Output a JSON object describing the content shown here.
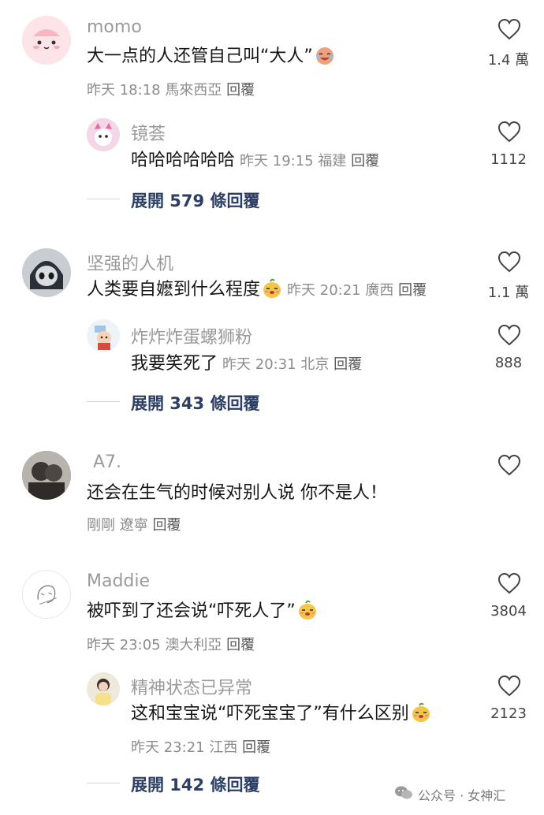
{
  "comments": [
    {
      "user": "momo",
      "text": "大一点的人还管自己叫“大人”",
      "time": "昨天 18:18",
      "location": "馬來西亞",
      "reply_label": "回覆",
      "likes": "1.4 萬",
      "emoji": "laugh-cry-emoji",
      "sub": {
        "user": "镜荟",
        "text": "哈哈哈哈哈哈",
        "time": "昨天 19:15",
        "location": "福建",
        "reply_label": "回覆",
        "likes": "1112"
      },
      "expand": "展開 579 條回覆"
    },
    {
      "user": "坚强的人机",
      "text": "人类要自嬷到什么程度",
      "time": "昨天 20:21",
      "location": "廣西",
      "reply_label": "回覆",
      "likes": "1.1 萬",
      "emoji": "smirk-pear-emoji",
      "sub": {
        "user": "炸炸炸蛋螺狮粉",
        "text": "我要笑死了",
        "time": "昨天 20:31",
        "location": "北京",
        "reply_label": "回覆",
        "likes": "888"
      },
      "expand": "展開 343 條回覆"
    },
    {
      "user": "A7.",
      "text": "还会在生气的时候对别人说 你不是人！",
      "time": "剛剛",
      "location": "遼寧",
      "reply_label": "回覆",
      "likes": ""
    },
    {
      "user": "Maddie",
      "text": "被吓到了还会说“吓死人了”",
      "time": "昨天 23:05",
      "location": "澳大利亞",
      "reply_label": "回覆",
      "likes": "3804",
      "emoji": "smirk-pear-emoji",
      "sub": {
        "user": "精神状态已异常",
        "text": "这和宝宝说“吓死宝宝了”有什么区别",
        "time": "昨天 23:21",
        "location": "江西",
        "reply_label": "回覆",
        "likes": "2123",
        "emoji": "smirk-pear-emoji"
      },
      "expand": "展開 142 條回覆"
    }
  ],
  "watermark": "公众号 · 女神汇",
  "colors": {
    "text": "#161616",
    "meta": "#8c8c8c",
    "username": "#9a9a9a",
    "expand": "#2c3e63",
    "divider": "#d6d6d6"
  }
}
